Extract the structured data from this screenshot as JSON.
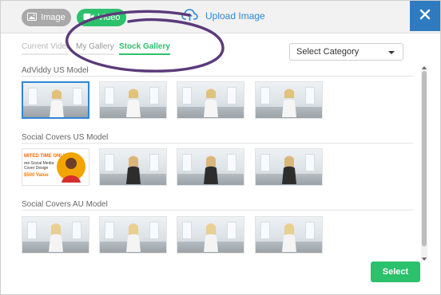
{
  "header": {
    "image_label": "Image",
    "video_label": "Video",
    "upload_label": "Upload Image",
    "close_icon": "close-icon"
  },
  "tabs": [
    {
      "label": "Current Video"
    },
    {
      "label": "My Gallery"
    },
    {
      "label": "Stock Gallery"
    }
  ],
  "category_select": {
    "value": "Select Category"
  },
  "sections": [
    {
      "title": "AdViddy US Model"
    },
    {
      "title": "Social Covers US Model"
    },
    {
      "title": "Social Covers AU Model"
    }
  ],
  "promo_thumb": {
    "line1": "MITED TIME ONLY!",
    "line2": "ree Social Media",
    "line3": "Cover Design",
    "line4": "$500 Value"
  },
  "footer": {
    "select_label": "Select"
  },
  "colors": {
    "primary_green": "#2cc16c",
    "accent_blue": "#2e86d6",
    "close_blue": "#2e7bbf",
    "annotation_purple": "#5b3a7a"
  },
  "icons": {
    "image": "image-icon",
    "video": "video-camera-icon",
    "upload": "cloud-upload-icon",
    "dropdown": "caret-down-icon"
  }
}
